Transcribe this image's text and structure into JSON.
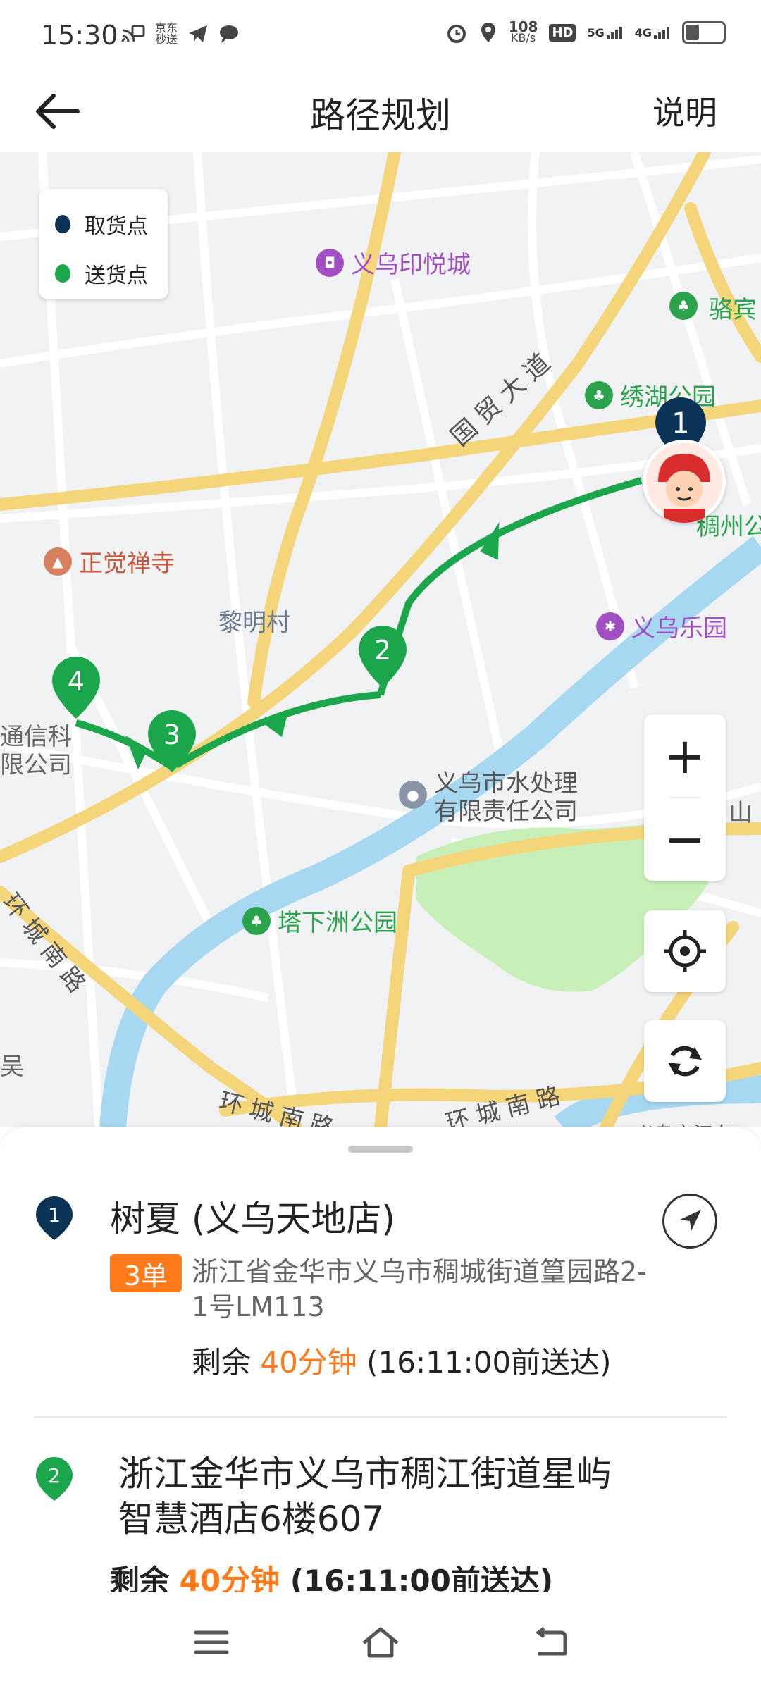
{
  "status": {
    "time": "15:30",
    "left_icon_jd": "京东\n秒送",
    "net_speed_top": "108",
    "net_speed_bottom": "KB/s",
    "hd": "HD",
    "sig1": "5G",
    "sig2": "4G",
    "battery_level": 0.4
  },
  "header": {
    "title": "路径规划",
    "help": "说明"
  },
  "legend": {
    "pickup": "取货点",
    "delivery": "送货点"
  },
  "map": {
    "labels": {
      "road1": "国贸大道",
      "road2": "环城南路",
      "road3": "环城南路",
      "road4": "环城南路",
      "village": "黎明村",
      "partial_tongxin": "通信科\n限公司",
      "partial_binwang": "骆宾",
      "partial_yuan": "稠州公",
      "partial_shan": "山",
      "partial_wu": "吴",
      "partial_bottom": "义乌市江东"
    },
    "pois": {
      "yinyue": "义乌印悦城",
      "xiuhu": "绣湖公园",
      "zhengjue": "正觉禅寺",
      "leyuan": "义乌乐园",
      "water": "义乌市水处理\n有限责任公司",
      "taxiazhou": "塔下洲公园"
    },
    "markers": [
      "1",
      "2",
      "3",
      "4"
    ]
  },
  "controls": {
    "zoom_in": "+",
    "zoom_out": "−"
  },
  "stops": [
    {
      "index": "1",
      "title": "树夏 (义乌天地店)",
      "orders": "3单",
      "address": "浙江省金华市义乌市稠城街道篁园路2-1号LM113",
      "remain_prefix": "剩余 ",
      "remain_time": "40分钟",
      "remain_suffix": " (16:11:00前送达)"
    },
    {
      "index": "2",
      "title": "浙江金华市义乌市稠江街道星屿智慧酒店6楼607",
      "remain_prefix": "剩余 ",
      "remain_time": "40分钟",
      "remain_suffix": " (16:11:00前送达)"
    }
  ],
  "colors": {
    "pickup": "#0b3356",
    "delivery": "#1ca64b",
    "accent": "#ff7a1a",
    "road": "#f5d57a",
    "water": "#a7d8f2",
    "park": "#c8efb8"
  }
}
